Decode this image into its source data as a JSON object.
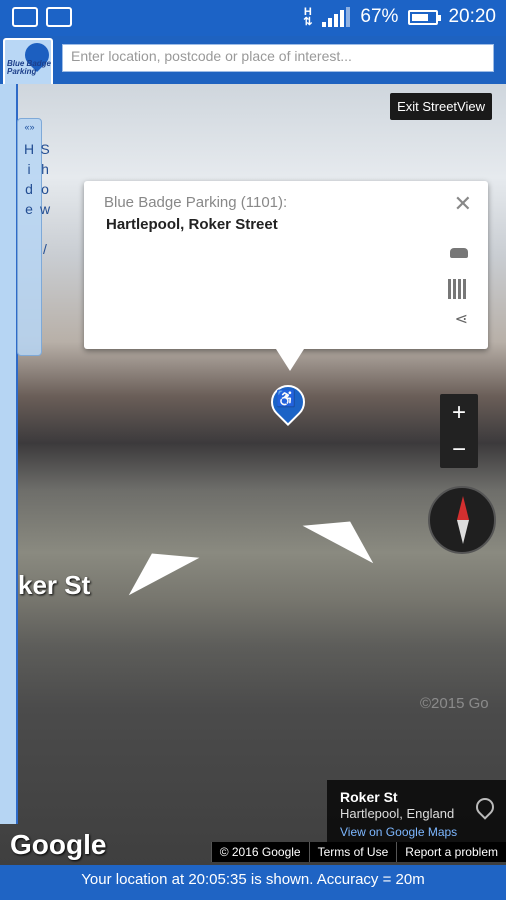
{
  "status_bar": {
    "network": "H",
    "battery": "67%",
    "time": "20:20"
  },
  "header": {
    "logo_text": "Blue Badge Parking",
    "search_placeholder": "Enter location, postcode or place of interest..."
  },
  "sidebar": {
    "toggle_label": "Show / Hide",
    "toggle_arrows": "«»"
  },
  "streetview": {
    "exit_label": "Exit StreetView",
    "street_label": "ker St",
    "watermark": "©2015 Go",
    "zoom_in": "+",
    "zoom_out": "−"
  },
  "popup": {
    "category": "Blue Badge Parking",
    "count": "(1101):",
    "address": "Hartlepool, Roker Street",
    "close": "✕",
    "share": "⋖"
  },
  "location_card": {
    "name": "Roker St",
    "place": "Hartlepool, England",
    "link": "View on Google Maps"
  },
  "footer": {
    "google_logo": "Google",
    "copyright": "© 2016 Google",
    "terms": "Terms of Use",
    "report": "Report a problem",
    "status_message": "Your location at 20:05:35 is shown. Accuracy = 20m"
  }
}
